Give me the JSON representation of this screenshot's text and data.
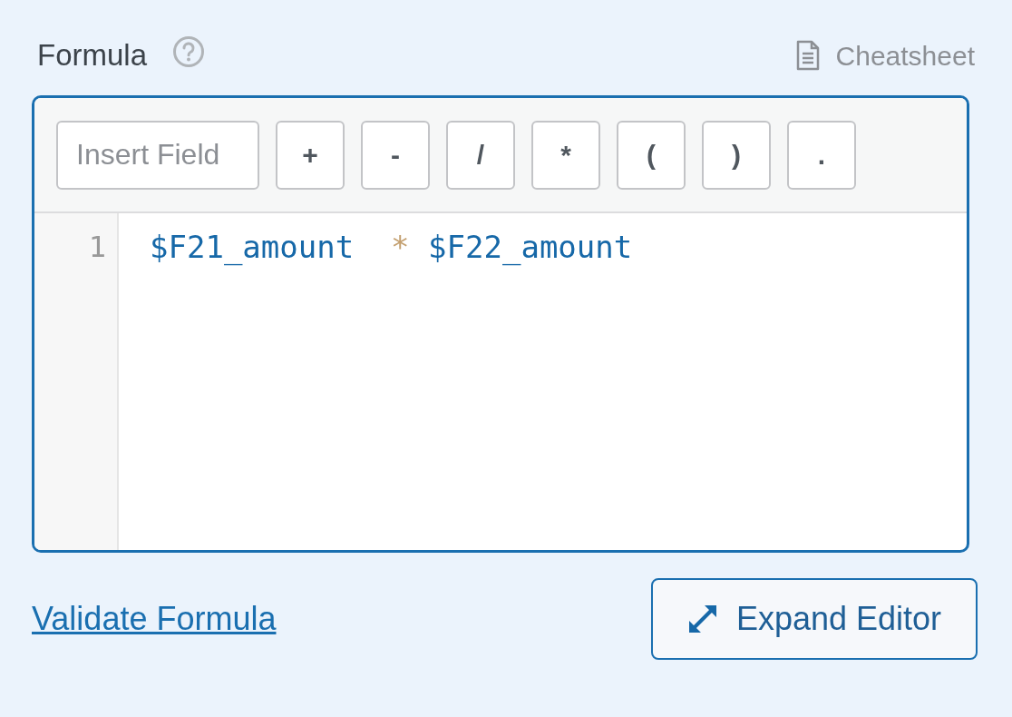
{
  "header": {
    "label": "Formula",
    "cheatsheet": "Cheatsheet"
  },
  "toolbar": {
    "insert_field": {
      "placeholder": "Insert Field"
    },
    "buttons": [
      "+",
      "-",
      "/",
      "*",
      "(",
      ")",
      "."
    ]
  },
  "editor": {
    "lines": [
      {
        "number": "1",
        "tokens": [
          {
            "text": "$F21_amount  ",
            "kind": "variable"
          },
          {
            "text": "*",
            "kind": "operator"
          },
          {
            "text": " $F22_amount",
            "kind": "variable"
          }
        ]
      }
    ]
  },
  "footer": {
    "link": "Validate Formula",
    "button": "Expand Editor"
  }
}
